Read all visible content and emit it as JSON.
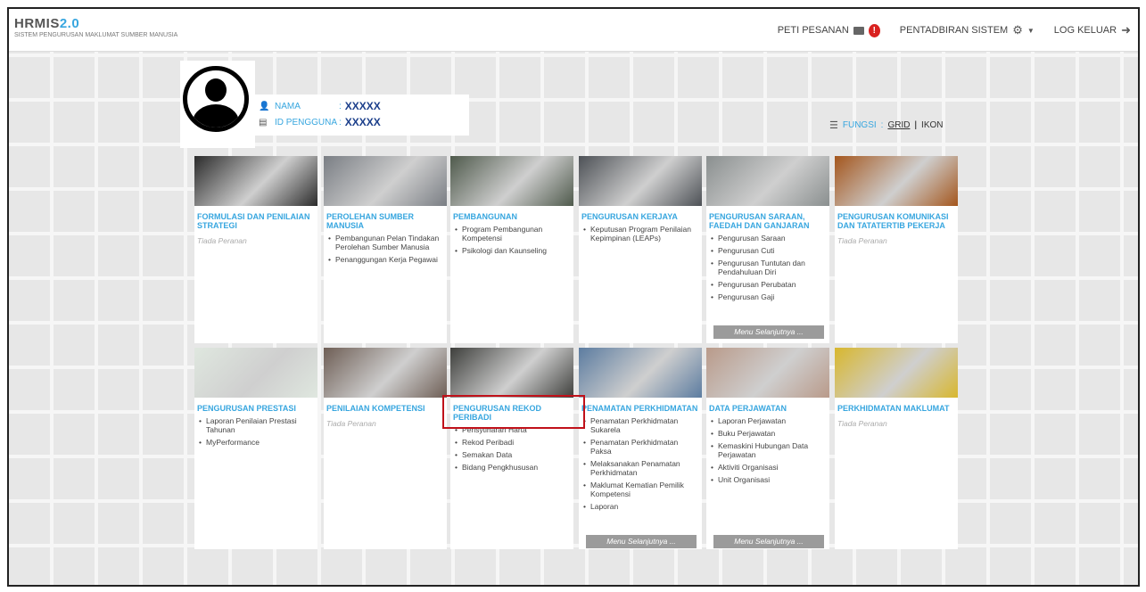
{
  "header": {
    "logo_text": "HRMIS",
    "logo_version": "2.0",
    "logo_subtitle": "SISTEM PENGURUSAN MAKLUMAT SUMBER MANUSIA",
    "inbox_label": "PETI PESANAN",
    "inbox_badge": "!",
    "admin_label": "PENTADBIRAN SISTEM",
    "logout_label": "LOG KELUAR"
  },
  "user": {
    "name_label": "NAMA",
    "name_sep": ":",
    "name_value": "XXXXX",
    "id_label": "ID PENGGUNA",
    "id_sep": ":",
    "id_value": "XXXXX"
  },
  "view_toggle": {
    "label": "FUNGSI",
    "sep": ":",
    "grid": "GRID",
    "divider": "|",
    "ikon": "IKON"
  },
  "tiles": [
    {
      "title": "FORMULASI DAN PENILAIAN STRATEGI",
      "items": [],
      "empty": "Tiada Peranan",
      "img_color": "#2b2b2b"
    },
    {
      "title": "PEROLEHAN SUMBER MANUSIA",
      "items": [
        "Pembangunan Pelan Tindakan Perolehan Sumber Manusia",
        "Penanggungan Kerja Pegawai"
      ],
      "img_color": "#7a7e84"
    },
    {
      "title": "PEMBANGUNAN",
      "items": [
        "Program Pembangunan Kompetensi",
        "Psikologi dan Kaunseling"
      ],
      "img_color": "#4f5a4c"
    },
    {
      "title": "PENGURUSAN KERJAYA",
      "items": [
        "Keputusan Program Penilaian Kepimpinan (LEAPs)"
      ],
      "img_color": "#4d5156"
    },
    {
      "title": "PENGURUSAN SARAAN, FAEDAH DAN GANJARAN",
      "items": [
        "Pengurusan Saraan",
        "Pengurusan Cuti",
        "Pengurusan Tuntutan dan Pendahuluan Diri",
        "Pengurusan Perubatan",
        "Pengurusan Gaji"
      ],
      "more": "Menu Selanjutnya ...",
      "img_color": "#8a8f8f"
    },
    {
      "title": "PENGURUSAN KOMUNIKASI DAN TATATERTIB PEKERJA",
      "items": [],
      "empty": "Tiada Peranan",
      "img_color": "#a4561d"
    },
    {
      "title": "PENGURUSAN PRESTASI",
      "items": [
        "Laporan Penilaian Prestasi Tahunan",
        "MyPerformance"
      ],
      "img_color": "#dfe7df"
    },
    {
      "title": "PENILAIAN KOMPETENSI",
      "items": [],
      "empty": "Tiada Peranan",
      "img_color": "#6e5e55"
    },
    {
      "title": "PENGURUSAN REKOD PERIBADI",
      "items": [
        "Perisytiharan Harta",
        "Rekod Peribadi",
        "Semakan Data",
        "Bidang Pengkhususan"
      ],
      "img_color": "#3e3f3c"
    },
    {
      "title": "PENAMATAN PERKHIDMATAN",
      "items": [
        "Penamatan Perkhidmatan Sukarela",
        "Penamatan Perkhidmatan Paksa",
        "Melaksanakan Penamatan Perkhidmatan",
        "Maklumat Kematian Pemilik Kompetensi",
        "Laporan"
      ],
      "more": "Menu Selanjutnya ...",
      "img_color": "#5c7ca0"
    },
    {
      "title": "DATA PERJAWATAN",
      "items": [
        "Laporan Perjawatan",
        "Buku Perjawatan",
        "Kemaskini Hubungan Data Perjawatan",
        "Aktiviti Organisasi",
        "Unit Organisasi"
      ],
      "more": "Menu Selanjutnya ...",
      "img_color": "#b99a8a"
    },
    {
      "title": "PERKHIDMATAN MAKLUMAT",
      "items": [],
      "empty": "Tiada Peranan",
      "img_color": "#d8b72e"
    }
  ],
  "colors": {
    "accent": "#37a6df",
    "highlight": "#c0111a"
  }
}
